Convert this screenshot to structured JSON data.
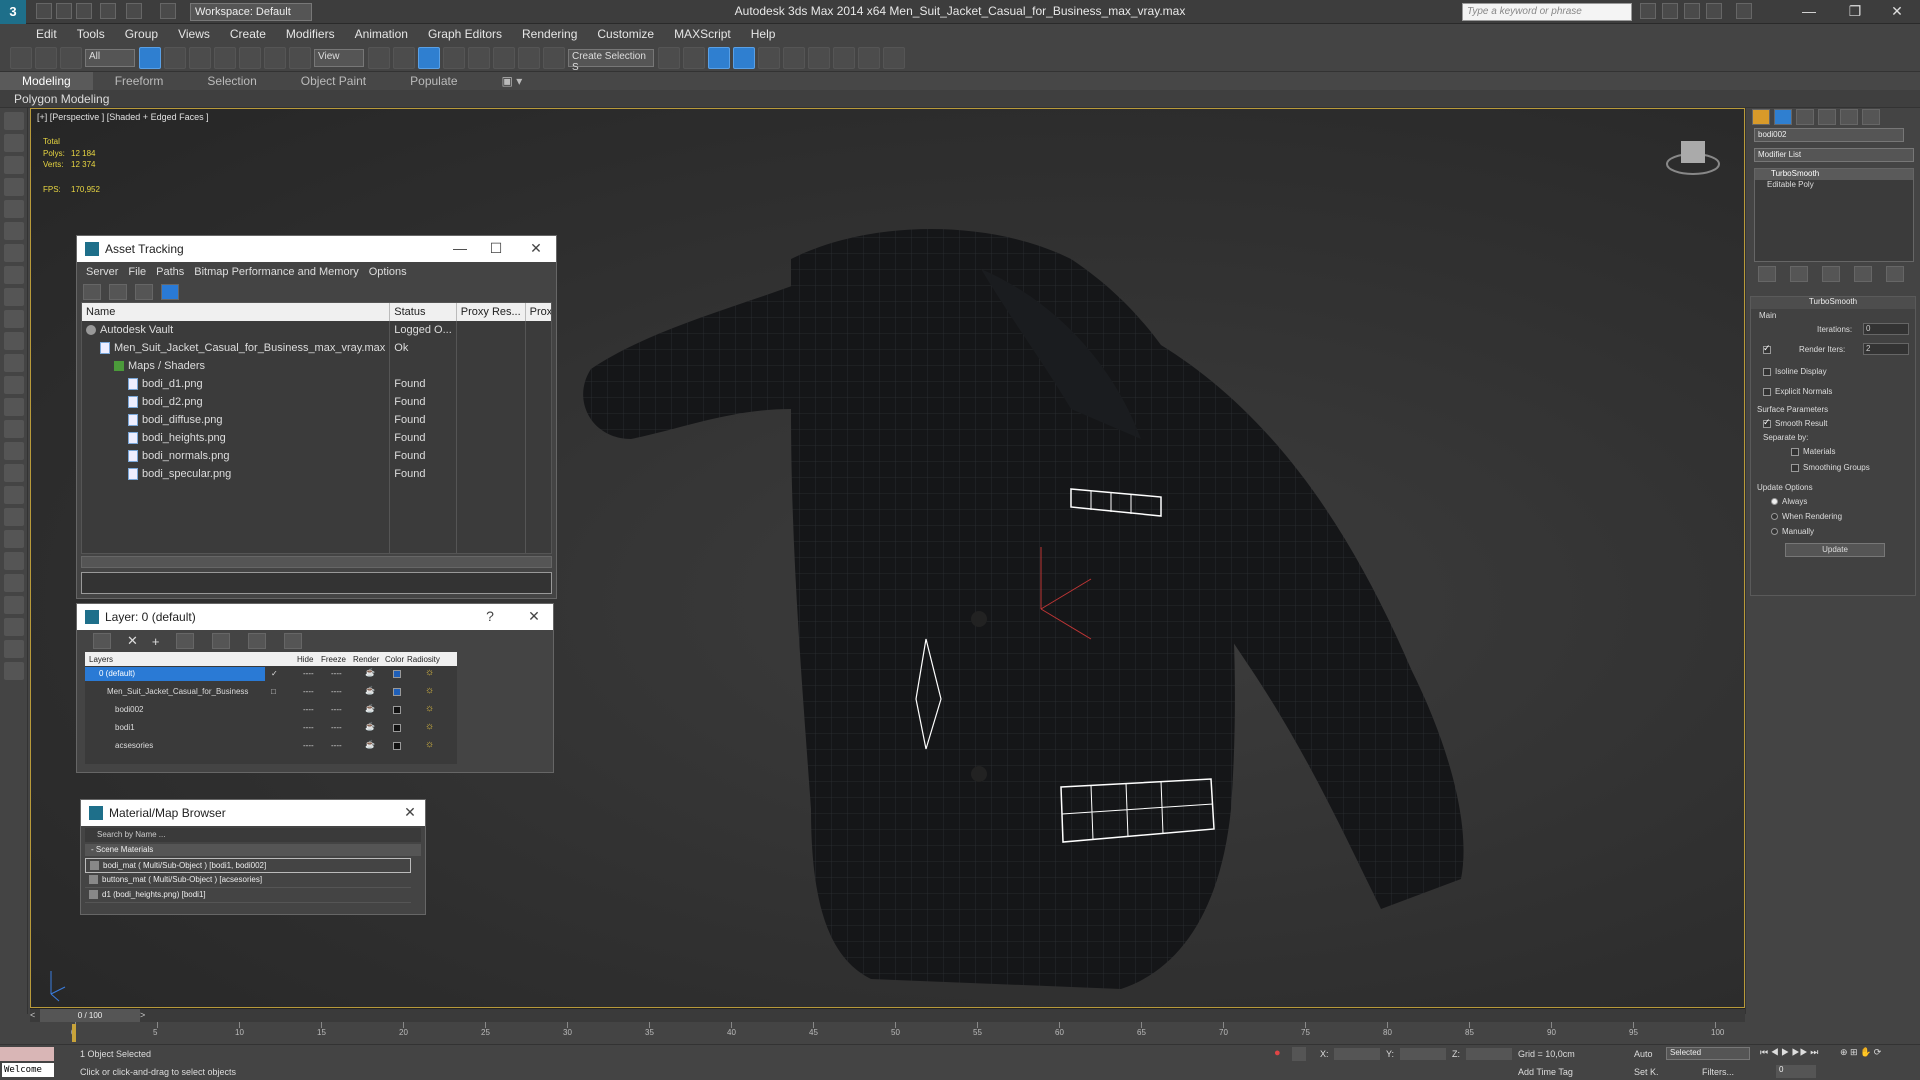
{
  "app": {
    "logo": "3",
    "title": "Autodesk 3ds Max  2014 x64      Men_Suit_Jacket_Casual_for_Business_max_vray.max",
    "workspace": "Workspace: Default",
    "search_placeholder": "Type a keyword or phrase",
    "win_min": "—",
    "win_max": "❐",
    "win_close": "✕"
  },
  "menu": [
    "Edit",
    "Tools",
    "Group",
    "Views",
    "Create",
    "Modifiers",
    "Animation",
    "Graph Editors",
    "Rendering",
    "Customize",
    "MAXScript",
    "Help"
  ],
  "toolbar": {
    "filter": "All",
    "ref_coord": "View",
    "named_sel": "Create Selection S"
  },
  "ribbon": {
    "tabs": [
      "Modeling",
      "Freeform",
      "Selection",
      "Object Paint",
      "Populate"
    ],
    "sub_label": "Polygon Modeling"
  },
  "viewport": {
    "label": "[+] [Perspective ] [Shaded + Edged Faces ]",
    "stats_total": "Total",
    "polys_label": "Polys:",
    "polys": "12 184",
    "verts_label": "Verts:",
    "verts": "12 374",
    "fps_label": "FPS:",
    "fps": "170,952"
  },
  "asset_tracking": {
    "title": "Asset Tracking",
    "menu": [
      "Server",
      "File",
      "Paths",
      "Bitmap Performance and Memory",
      "Options"
    ],
    "columns": [
      "Name",
      "Status",
      "Proxy Res...",
      "Proxy"
    ],
    "rows": [
      {
        "name": "Autodesk Vault",
        "status": "Logged O...",
        "indent": 0,
        "icon": "vault"
      },
      {
        "name": "Men_Suit_Jacket_Casual_for_Business_max_vray.max",
        "status": "Ok",
        "indent": 1,
        "icon": "file"
      },
      {
        "name": "Maps / Shaders",
        "status": "",
        "indent": 2,
        "icon": "folder"
      },
      {
        "name": "bodi_d1.png",
        "status": "Found",
        "indent": 3,
        "icon": "file"
      },
      {
        "name": "bodi_d2.png",
        "status": "Found",
        "indent": 3,
        "icon": "file"
      },
      {
        "name": "bodi_diffuse.png",
        "status": "Found",
        "indent": 3,
        "icon": "file"
      },
      {
        "name": "bodi_heights.png",
        "status": "Found",
        "indent": 3,
        "icon": "file"
      },
      {
        "name": "bodi_normals.png",
        "status": "Found",
        "indent": 3,
        "icon": "file"
      },
      {
        "name": "bodi_specular.png",
        "status": "Found",
        "indent": 3,
        "icon": "file"
      }
    ]
  },
  "layer_dialog": {
    "title": "Layer: 0 (default)",
    "help": "?",
    "columns": [
      "Layers",
      "Hide",
      "Freeze",
      "Render",
      "Color",
      "Radiosity"
    ],
    "layers": [
      {
        "name": "0 (default)",
        "indent": 0,
        "selected": true,
        "color": "#1f5fb8",
        "check": "✓"
      },
      {
        "name": "Men_Suit_Jacket_Casual_for_Business",
        "indent": 1,
        "selected": false,
        "color": "#1f5fb8",
        "check": "□"
      },
      {
        "name": "bodi002",
        "indent": 2,
        "selected": false,
        "color": "#111111",
        "check": ""
      },
      {
        "name": "bodi1",
        "indent": 2,
        "selected": false,
        "color": "#111111",
        "check": ""
      },
      {
        "name": "acsesories",
        "indent": 2,
        "selected": false,
        "color": "#111111",
        "check": ""
      }
    ],
    "dash": "----"
  },
  "material_browser": {
    "title": "Material/Map Browser",
    "search_placeholder": "Search by Name ...",
    "group": "- Scene Materials",
    "items": [
      "bodi_mat  ( Multi/Sub-Object ) [bodi1, bodi002]",
      "buttons_mat  ( Multi/Sub-Object ) [acsesories]",
      "d1 (bodi_heights.png) [bodi1]"
    ]
  },
  "command_panel": {
    "object_name": "bodi002",
    "modifier_list": "Modifier List",
    "stack": [
      "TurboSmooth",
      "Editable Poly"
    ],
    "rollout_title": "TurboSmooth",
    "main_label": "Main",
    "iterations_label": "Iterations:",
    "iterations": "0",
    "render_iters_label": "Render Iters:",
    "render_iters": "2",
    "isoline": "Isoline Display",
    "explicit": "Explicit Normals",
    "surface_label": "Surface Parameters",
    "smooth_result": "Smooth Result",
    "separate_by": "Separate by:",
    "materials": "Materials",
    "smoothing_groups": "Smoothing Groups",
    "update_label": "Update Options",
    "always": "Always",
    "when_rendering": "When Rendering",
    "manually": "Manually",
    "update_btn": "Update"
  },
  "timeline": {
    "frame": "0 / 100",
    "ticks": [
      "0",
      "5",
      "10",
      "15",
      "20",
      "25",
      "30",
      "35",
      "40",
      "45",
      "50",
      "55",
      "60",
      "65",
      "70",
      "75",
      "80",
      "85",
      "90",
      "95",
      "100"
    ]
  },
  "status": {
    "welcome": "Welcome to",
    "selected": "1 Object Selected",
    "prompt": "Click or click-and-drag to select objects",
    "x_label": "X:",
    "y_label": "Y:",
    "z_label": "Z:",
    "grid": "Grid = 10,0cm",
    "add_time_tag": "Add Time Tag",
    "auto": "Auto",
    "selected_dd": "Selected",
    "setk": "Set K.",
    "filters": "Filters...",
    "frame_value": "0"
  }
}
